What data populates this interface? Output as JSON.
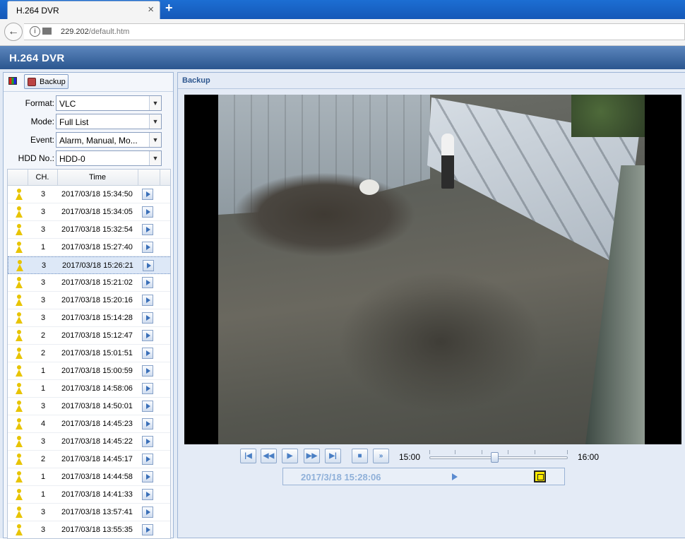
{
  "browser": {
    "tab_title": "H.264 DVR",
    "tab_close": "×",
    "new_tab": "+",
    "back": "←",
    "info": "i",
    "url_host": "229.202",
    "url_path": "/default.htm"
  },
  "app": {
    "title": "H.264 DVR"
  },
  "left_panel": {
    "backup_button": "Backup",
    "form": {
      "format": {
        "label": "Format:",
        "value": "VLC"
      },
      "mode": {
        "label": "Mode:",
        "value": "Full List"
      },
      "event": {
        "label": "Event:",
        "value": "Alarm, Manual, Mo..."
      },
      "hdd": {
        "label": "HDD No.:",
        "value": "HDD-0"
      }
    },
    "table": {
      "headers": {
        "ch": "CH.",
        "time": "Time"
      },
      "rows": [
        {
          "ch": "3",
          "time": "2017/03/18 15:34:50"
        },
        {
          "ch": "3",
          "time": "2017/03/18 15:34:05"
        },
        {
          "ch": "3",
          "time": "2017/03/18 15:32:54"
        },
        {
          "ch": "1",
          "time": "2017/03/18 15:27:40"
        },
        {
          "ch": "3",
          "time": "2017/03/18 15:26:21",
          "selected": true
        },
        {
          "ch": "3",
          "time": "2017/03/18 15:21:02"
        },
        {
          "ch": "3",
          "time": "2017/03/18 15:20:16"
        },
        {
          "ch": "3",
          "time": "2017/03/18 15:14:28"
        },
        {
          "ch": "2",
          "time": "2017/03/18 15:12:47"
        },
        {
          "ch": "2",
          "time": "2017/03/18 15:01:51"
        },
        {
          "ch": "1",
          "time": "2017/03/18 15:00:59"
        },
        {
          "ch": "1",
          "time": "2017/03/18 14:58:06"
        },
        {
          "ch": "3",
          "time": "2017/03/18 14:50:01"
        },
        {
          "ch": "4",
          "time": "2017/03/18 14:45:23"
        },
        {
          "ch": "3",
          "time": "2017/03/18 14:45:22"
        },
        {
          "ch": "2",
          "time": "2017/03/18 14:45:17"
        },
        {
          "ch": "1",
          "time": "2017/03/18 14:44:58"
        },
        {
          "ch": "1",
          "time": "2017/03/18 14:41:33"
        },
        {
          "ch": "3",
          "time": "2017/03/18 13:57:41"
        },
        {
          "ch": "3",
          "time": "2017/03/18 13:55:35"
        }
      ]
    }
  },
  "right_panel": {
    "title": "Backup",
    "player": {
      "time_start": "15:00",
      "time_end": "16:00",
      "slider_position": 0.47,
      "current_time": "2017/3/18 15:28:06"
    }
  },
  "colors": {
    "app_header": "#2b568f",
    "accent_text": "#2f5890",
    "event_icon": "#e8c400"
  }
}
